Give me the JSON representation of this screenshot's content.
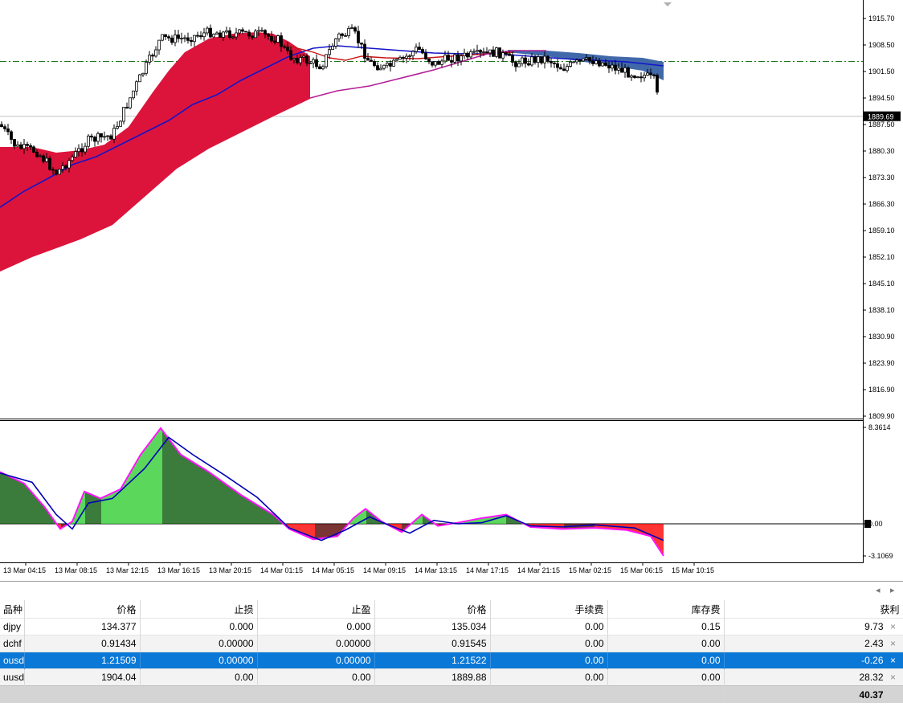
{
  "price_axis": {
    "labels": [
      "1915.70",
      "1908.50",
      "1901.50",
      "1894.50",
      "1887.50",
      "1880.30",
      "1873.30",
      "1866.30",
      "1859.10",
      "1852.10",
      "1845.10",
      "1838.10",
      "1830.90",
      "1823.90",
      "1816.90",
      "1809.90"
    ],
    "current_price": "1889.69"
  },
  "oscillator_axis": {
    "max": "8.3614",
    "zero": "0.00",
    "min": "-3.1069"
  },
  "time_axis": [
    "13 Mar 04:15",
    "13 Mar 08:15",
    "13 Mar 12:15",
    "13 Mar 16:15",
    "13 Mar 20:15",
    "14 Mar 01:15",
    "14 Mar 05:15",
    "14 Mar 09:15",
    "14 Mar 13:15",
    "14 Mar 17:15",
    "14 Mar 21:15",
    "15 Mar 02:15",
    "15 Mar 06:15",
    "15 Mar 10:15"
  ],
  "nav": {
    "left_icon": "scroll-left-icon",
    "right_icon": "scroll-right-icon"
  },
  "colors": {
    "bull_candle": "#ffffff",
    "bear_candle": "#000000",
    "cloud_red": "#dc143c",
    "cloud_blue": "#4169aa",
    "ma_blue": "#1414c8",
    "ma_red": "#c81414",
    "ma_magenta": "#b41e96",
    "hist_green": "#32cd32",
    "hist_darkgreen": "#0a5a0a",
    "hist_red": "#ff0000",
    "hist_darkred": "#5a0000",
    "signal_line": "#0000b4",
    "osc_line": "#ff14ff",
    "grid_dash": "#1e781e",
    "selected_row": "#0a78d7"
  },
  "positions": {
    "headers": [
      "品种",
      "价格",
      "止损",
      "止盈",
      "价格",
      "手续费",
      "库存费",
      "获利"
    ],
    "rows": [
      {
        "symbol": "djpy",
        "open_price": "134.377",
        "sl": "0.000",
        "tp": "0.000",
        "price": "135.034",
        "commission": "0.00",
        "swap": "0.15",
        "profit": "9.73"
      },
      {
        "symbol": "dchf",
        "open_price": "0.91434",
        "sl": "0.00000",
        "tp": "0.00000",
        "price": "0.91545",
        "commission": "0.00",
        "swap": "0.00",
        "profit": "2.43"
      },
      {
        "symbol": "ousd",
        "open_price": "1.21509",
        "sl": "0.00000",
        "tp": "0.00000",
        "price": "1.21522",
        "commission": "0.00",
        "swap": "0.00",
        "profit": "-0.26"
      },
      {
        "symbol": "uusd",
        "open_price": "1904.04",
        "sl": "0.00",
        "tp": "0.00",
        "price": "1889.88",
        "commission": "0.00",
        "swap": "0.00",
        "profit": "28.32"
      }
    ],
    "close_icon": "×",
    "total_profit": "40.37"
  }
}
